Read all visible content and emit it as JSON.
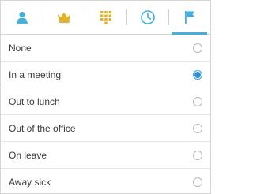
{
  "tabs": [
    {
      "icon": "user-icon",
      "active": false
    },
    {
      "icon": "crown-icon",
      "active": false
    },
    {
      "icon": "keypad-icon",
      "active": false
    },
    {
      "icon": "clock-icon",
      "active": false
    },
    {
      "icon": "flag-icon",
      "active": true
    }
  ],
  "colors": {
    "icon_blue": "#3fb0e0",
    "icon_gold": "#e5b321",
    "radio_checked": "#2f8fd6"
  },
  "statuses": [
    {
      "label": "None",
      "selected": false
    },
    {
      "label": "In a meeting",
      "selected": true
    },
    {
      "label": "Out to lunch",
      "selected": false
    },
    {
      "label": "Out of the office",
      "selected": false
    },
    {
      "label": "On leave",
      "selected": false
    },
    {
      "label": "Away sick",
      "selected": false
    }
  ]
}
